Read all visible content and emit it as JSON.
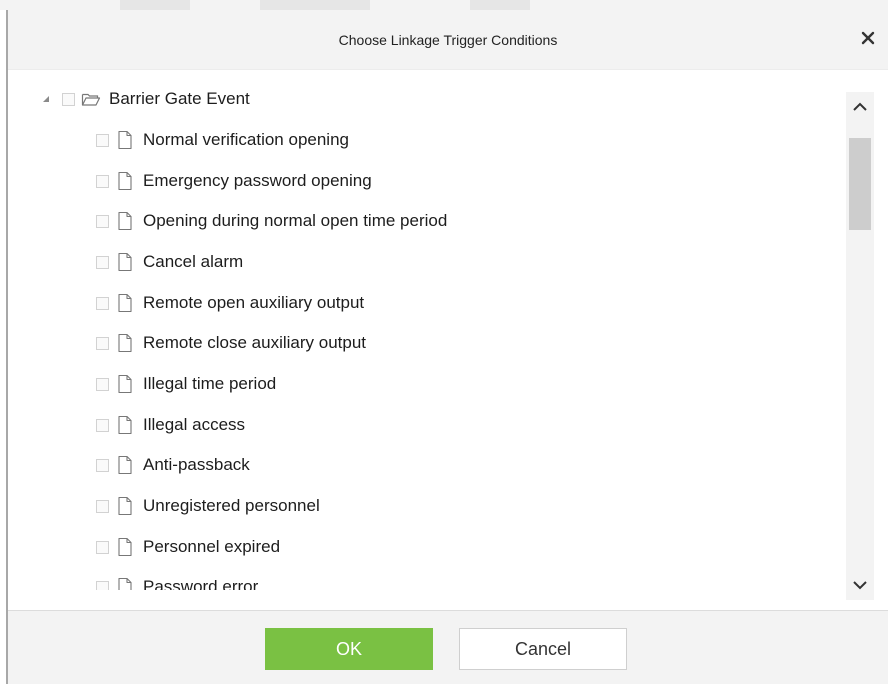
{
  "dialog": {
    "title": "Choose Linkage Trigger Conditions",
    "close_icon": "close-icon"
  },
  "tree": {
    "root": {
      "label": "Barrier Gate Event",
      "expanded": true,
      "checked": false,
      "icon": "folder-open-icon"
    },
    "items": [
      {
        "label": "Normal verification opening",
        "checked": false,
        "icon": "file-icon"
      },
      {
        "label": "Emergency password opening",
        "checked": false,
        "icon": "file-icon"
      },
      {
        "label": "Opening during normal open time period",
        "checked": false,
        "icon": "file-icon"
      },
      {
        "label": "Cancel alarm",
        "checked": false,
        "icon": "file-icon"
      },
      {
        "label": "Remote open auxiliary output",
        "checked": false,
        "icon": "file-icon"
      },
      {
        "label": "Remote close auxiliary output",
        "checked": false,
        "icon": "file-icon"
      },
      {
        "label": "Illegal time period",
        "checked": false,
        "icon": "file-icon"
      },
      {
        "label": "Illegal access",
        "checked": false,
        "icon": "file-icon"
      },
      {
        "label": "Anti-passback",
        "checked": false,
        "icon": "file-icon"
      },
      {
        "label": "Unregistered personnel",
        "checked": false,
        "icon": "file-icon"
      },
      {
        "label": "Personnel expired",
        "checked": false,
        "icon": "file-icon"
      },
      {
        "label": "Password error",
        "checked": false,
        "icon": "file-icon"
      }
    ]
  },
  "scrollbar": {
    "up_icon": "chevron-up-icon",
    "down_icon": "chevron-down-icon"
  },
  "footer": {
    "ok_label": "OK",
    "cancel_label": "Cancel"
  },
  "colors": {
    "ok_button": "#7ac143",
    "header_bg": "#f3f3f3",
    "footer_bg": "#f3f3f3"
  }
}
